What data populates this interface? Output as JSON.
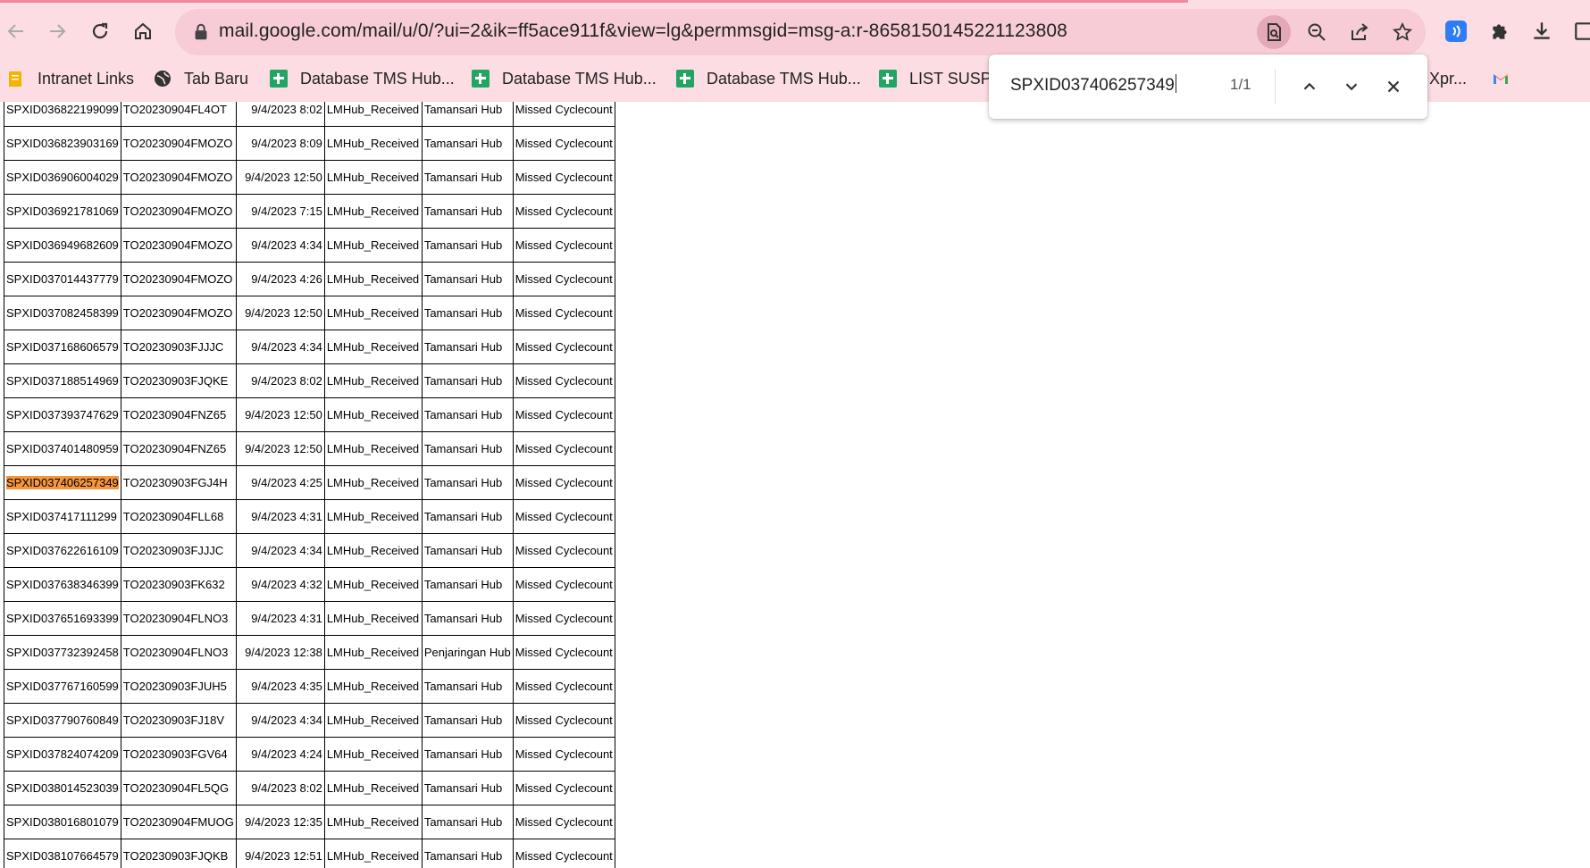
{
  "browser": {
    "url": "mail.google.com/mail/u/0/?ui=2&ik=ff5ace911f&view=lg&permmsgid=msg-a:r-8658150145221123808",
    "bookmarks": [
      {
        "label": "Intranet Links",
        "icon": "folder-icon"
      },
      {
        "label": "Tab Baru",
        "icon": "globe-icon"
      },
      {
        "label": "Database TMS Hub...",
        "icon": "sheets-icon"
      },
      {
        "label": "Database TMS Hub...",
        "icon": "sheets-icon"
      },
      {
        "label": "Database TMS Hub...",
        "icon": "sheets-icon"
      },
      {
        "label": "LIST SUSPE",
        "icon": "sheets-icon"
      },
      {
        "label": "Xpr...",
        "icon": ""
      },
      {
        "label": "",
        "icon": "gmail-icon"
      }
    ],
    "colors": {
      "chrome_bg": "#fbdde3",
      "omnibox_bg": "#f7ccd6",
      "accent": "#f2889e"
    }
  },
  "find_bar": {
    "query": "SPXID037406257349",
    "count": "1/1"
  },
  "table": {
    "highlight_color": "#f5963c",
    "rows": [
      [
        "SPXID036822199099",
        "TO20230904FL4OT",
        "9/4/2023 8:02",
        "LMHub_Received",
        "Tamansari Hub",
        "Missed Cyclecount"
      ],
      [
        "SPXID036823903169",
        "TO20230904FMOZO",
        "9/4/2023 8:09",
        "LMHub_Received",
        "Tamansari Hub",
        "Missed Cyclecount"
      ],
      [
        "SPXID036906004029",
        "TO20230904FMOZO",
        "9/4/2023 12:50",
        "LMHub_Received",
        "Tamansari Hub",
        "Missed Cyclecount"
      ],
      [
        "SPXID036921781069",
        "TO20230904FMOZO",
        "9/4/2023 7:15",
        "LMHub_Received",
        "Tamansari Hub",
        "Missed Cyclecount"
      ],
      [
        "SPXID036949682609",
        "TO20230904FMOZO",
        "9/4/2023 4:34",
        "LMHub_Received",
        "Tamansari Hub",
        "Missed Cyclecount"
      ],
      [
        "SPXID037014437779",
        "TO20230904FMOZO",
        "9/4/2023 4:26",
        "LMHub_Received",
        "Tamansari Hub",
        "Missed Cyclecount"
      ],
      [
        "SPXID037082458399",
        "TO20230904FMOZO",
        "9/4/2023 12:50",
        "LMHub_Received",
        "Tamansari Hub",
        "Missed Cyclecount"
      ],
      [
        "SPXID037168606579",
        "TO20230903FJJJC",
        "9/4/2023 4:34",
        "LMHub_Received",
        "Tamansari Hub",
        "Missed Cyclecount"
      ],
      [
        "SPXID037188514969",
        "TO20230903FJQKE",
        "9/4/2023 8:02",
        "LMHub_Received",
        "Tamansari Hub",
        "Missed Cyclecount"
      ],
      [
        "SPXID037393747629",
        "TO20230904FNZ65",
        "9/4/2023 12:50",
        "LMHub_Received",
        "Tamansari Hub",
        "Missed Cyclecount"
      ],
      [
        "SPXID037401480959",
        "TO20230904FNZ65",
        "9/4/2023 12:50",
        "LMHub_Received",
        "Tamansari Hub",
        "Missed Cyclecount"
      ],
      [
        "SPXID037406257349",
        "TO20230903FGJ4H",
        "9/4/2023 4:25",
        "LMHub_Received",
        "Tamansari Hub",
        "Missed Cyclecount"
      ],
      [
        "SPXID037417111299",
        "TO20230904FLL68",
        "9/4/2023 4:31",
        "LMHub_Received",
        "Tamansari Hub",
        "Missed Cyclecount"
      ],
      [
        "SPXID037622616109",
        "TO20230903FJJJC",
        "9/4/2023 4:34",
        "LMHub_Received",
        "Tamansari Hub",
        "Missed Cyclecount"
      ],
      [
        "SPXID037638346399",
        "TO20230903FK632",
        "9/4/2023 4:32",
        "LMHub_Received",
        "Tamansari Hub",
        "Missed Cyclecount"
      ],
      [
        "SPXID037651693399",
        "TO20230904FLNO3",
        "9/4/2023 4:31",
        "LMHub_Received",
        "Tamansari Hub",
        "Missed Cyclecount"
      ],
      [
        "SPXID037732392458",
        "TO20230904FLNO3",
        "9/4/2023 12:38",
        "LMHub_Received",
        "Penjaringan Hub",
        "Missed Cyclecount"
      ],
      [
        "SPXID037767160599",
        "TO20230903FJUH5",
        "9/4/2023 4:35",
        "LMHub_Received",
        "Tamansari Hub",
        "Missed Cyclecount"
      ],
      [
        "SPXID037790760849",
        "TO20230903FJ18V",
        "9/4/2023 4:34",
        "LMHub_Received",
        "Tamansari Hub",
        "Missed Cyclecount"
      ],
      [
        "SPXID037824074209",
        "TO20230903FGV64",
        "9/4/2023 4:24",
        "LMHub_Received",
        "Tamansari Hub",
        "Missed Cyclecount"
      ],
      [
        "SPXID038014523039",
        "TO20230904FL5QG",
        "9/4/2023 8:02",
        "LMHub_Received",
        "Tamansari Hub",
        "Missed Cyclecount"
      ],
      [
        "SPXID038016801079",
        "TO20230904FMUOG",
        "9/4/2023 12:35",
        "LMHub_Received",
        "Tamansari Hub",
        "Missed Cyclecount"
      ],
      [
        "SPXID038107664579",
        "TO20230903FJQKB",
        "9/4/2023 12:51",
        "LMHub_Received",
        "Tamansari Hub",
        "Missed Cyclecount"
      ]
    ]
  }
}
